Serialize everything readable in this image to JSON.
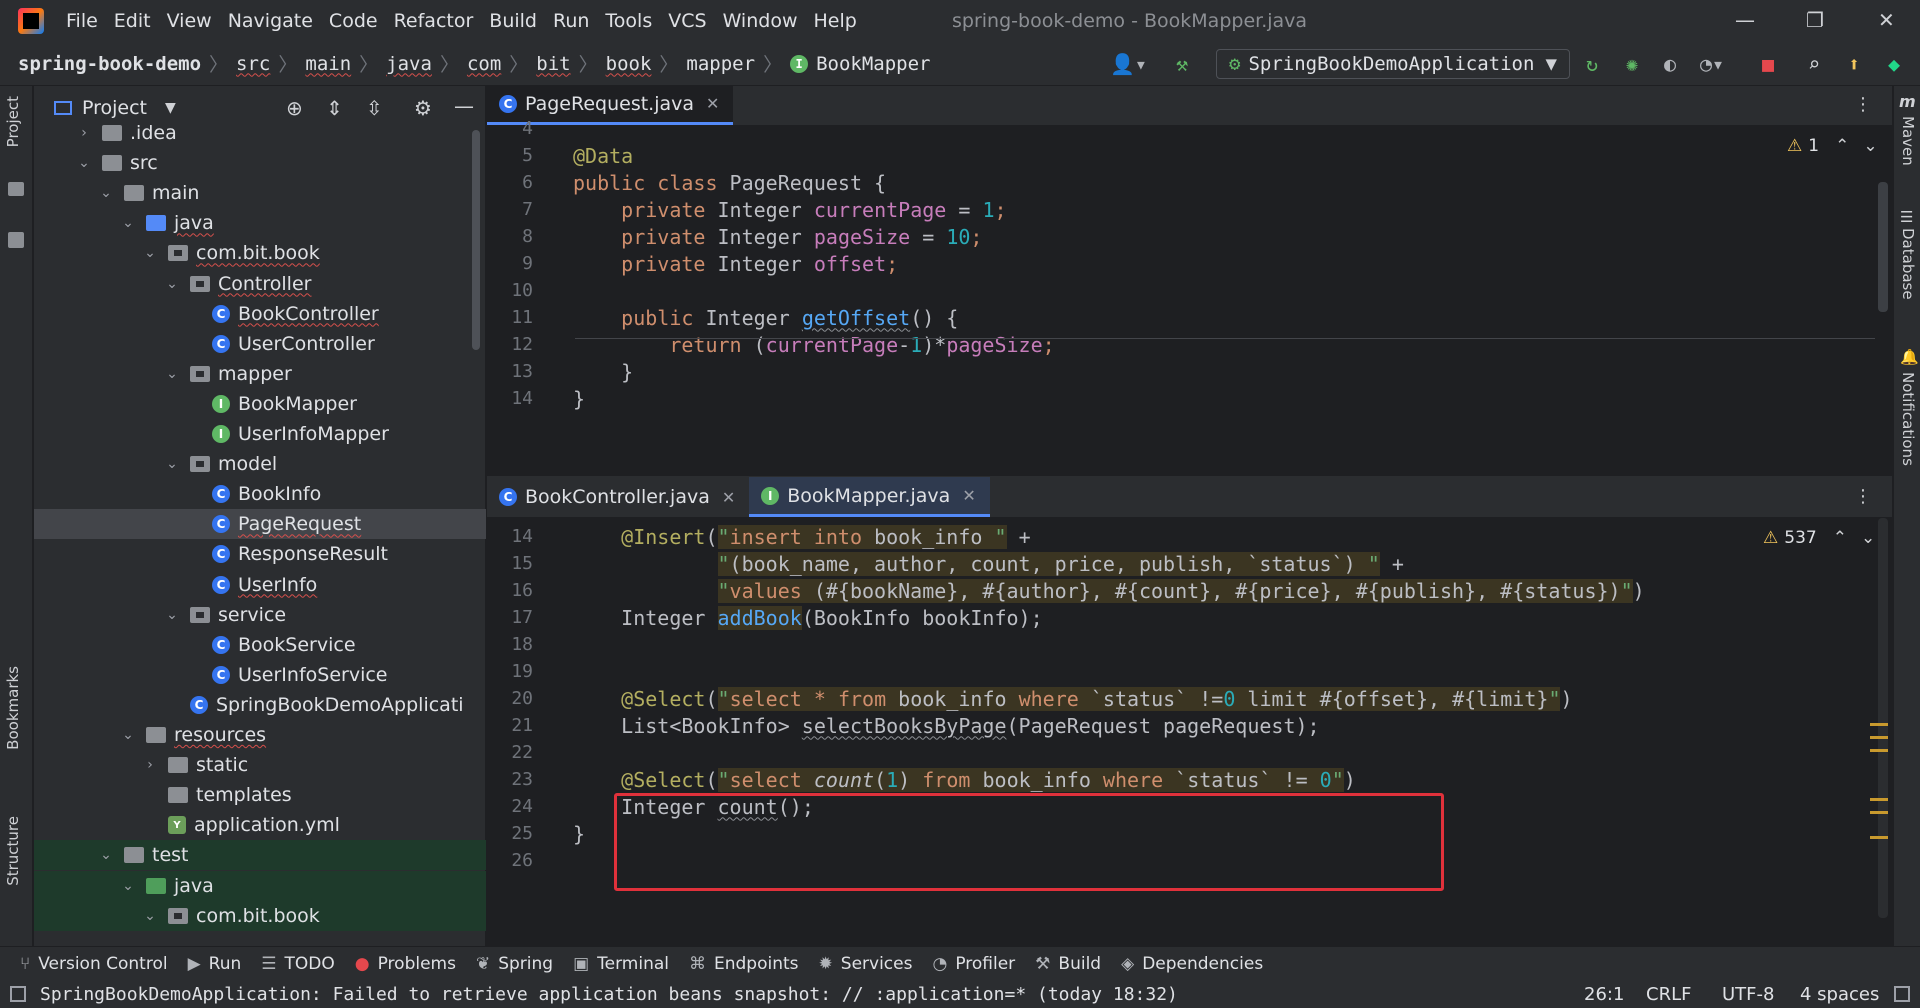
{
  "title_bar": {
    "menus": [
      "File",
      "Edit",
      "View",
      "Navigate",
      "Code",
      "Refactor",
      "Build",
      "Run",
      "Tools",
      "VCS",
      "Window",
      "Help"
    ],
    "window_title": "spring-book-demo - BookMapper.java",
    "minimize": "—",
    "restore": "❐",
    "close": "✕"
  },
  "nav_bar": {
    "breadcrumbs": [
      "spring-book-demo",
      "src",
      "main",
      "java",
      "com",
      "bit",
      "book",
      "mapper",
      "BookMapper"
    ],
    "run_config": "SpringBookDemoApplication"
  },
  "left_strip": {
    "project": "Project",
    "bookmarks": "Bookmarks",
    "structure": "Structure"
  },
  "right_strip": {
    "maven": "Maven",
    "database": "Database",
    "notifications": "Notifications"
  },
  "project_panel": {
    "title": "Project",
    "tree": [
      {
        "label": ".idea",
        "icon": "folder"
      },
      {
        "label": "src",
        "icon": "folder"
      },
      {
        "label": "main",
        "icon": "folder"
      },
      {
        "label": "java",
        "icon": "folder-blue"
      },
      {
        "label": "com.bit.book",
        "icon": "package"
      },
      {
        "label": "Controller",
        "icon": "package"
      },
      {
        "label": "BookController",
        "icon": "class"
      },
      {
        "label": "UserController",
        "icon": "class"
      },
      {
        "label": "mapper",
        "icon": "package"
      },
      {
        "label": "BookMapper",
        "icon": "interface"
      },
      {
        "label": "UserInfoMapper",
        "icon": "interface"
      },
      {
        "label": "model",
        "icon": "package"
      },
      {
        "label": "BookInfo",
        "icon": "class"
      },
      {
        "label": "PageRequest",
        "icon": "class"
      },
      {
        "label": "ResponseResult",
        "icon": "class"
      },
      {
        "label": "UserInfo",
        "icon": "class"
      },
      {
        "label": "service",
        "icon": "package"
      },
      {
        "label": "BookService",
        "icon": "class"
      },
      {
        "label": "UserInfoService",
        "icon": "class"
      },
      {
        "label": "SpringBookDemoApplicati",
        "icon": "spring-class"
      },
      {
        "label": "resources",
        "icon": "folder"
      },
      {
        "label": "static",
        "icon": "folder"
      },
      {
        "label": "templates",
        "icon": "folder"
      },
      {
        "label": "application.yml",
        "icon": "yml"
      },
      {
        "label": "test",
        "icon": "folder"
      },
      {
        "label": "java",
        "icon": "folder-green"
      },
      {
        "label": "com.bit.book",
        "icon": "package"
      }
    ]
  },
  "editor_top": {
    "tab": "PageRequest.java",
    "warnings": "1",
    "line_numbers": [
      "4",
      "5",
      "6",
      "7",
      "8",
      "9",
      "10",
      "11",
      "12",
      "13",
      "14"
    ]
  },
  "editor_bottom": {
    "tabs": [
      "BookController.java",
      "BookMapper.java"
    ],
    "warnings": "537",
    "line_numbers": [
      "14",
      "15",
      "16",
      "17",
      "18",
      "19",
      "20",
      "21",
      "22",
      "23",
      "24",
      "25",
      "26"
    ]
  },
  "tool_window_bar": [
    "Version Control",
    "Run",
    "TODO",
    "Problems",
    "Spring",
    "Terminal",
    "Endpoints",
    "Services",
    "Profiler",
    "Build",
    "Dependencies"
  ],
  "status_bar": {
    "message": "SpringBookDemoApplication: Failed to retrieve application beans snapshot: // :application=* (today 18:32)",
    "position": "26:1",
    "line_sep": "CRLF",
    "encoding": "UTF-8",
    "indent": "4 spaces"
  },
  "colors": {
    "accent": "#548af7",
    "highlight_box": "#e0313b"
  }
}
